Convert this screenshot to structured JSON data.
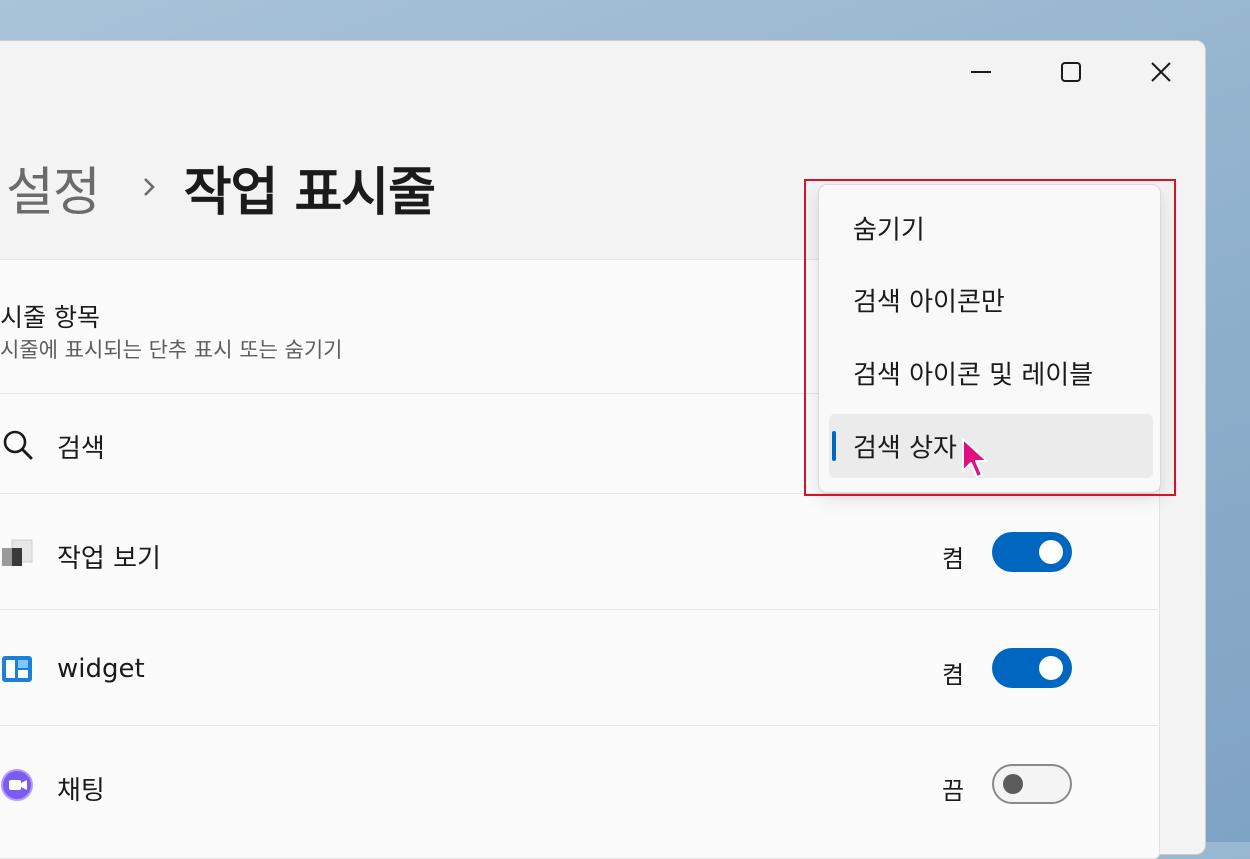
{
  "window": {
    "controls": {
      "minimize": "minimize-icon",
      "maximize": "maximize-icon",
      "close": "close-icon"
    }
  },
  "breadcrumb": {
    "parent": "설정",
    "separator_icon": "chevron-right-icon",
    "current": "작업 표시줄"
  },
  "section": {
    "title": "시줄 항목",
    "subtitle": "시줄에 표시되는 단추 표시 또는 숨기기"
  },
  "items": [
    {
      "icon": "search-icon",
      "label": "검색"
    },
    {
      "icon": "task-view-icon",
      "label": "작업 보기",
      "state_label": "켬",
      "on": true
    },
    {
      "icon": "widgets-icon",
      "label": "widget",
      "state_label": "켬",
      "on": true
    },
    {
      "icon": "chat-icon",
      "label": "채팅",
      "state_label": "끔",
      "on": false
    }
  ],
  "search_dropdown": {
    "options": [
      "숨기기",
      "검색 아이콘만",
      "검색 아이콘 및 레이블",
      "검색 상자"
    ],
    "selected": "검색 상자"
  },
  "colors": {
    "accent": "#0067c0",
    "highlight_box": "#d4122a",
    "cursor": "#e0117f"
  }
}
